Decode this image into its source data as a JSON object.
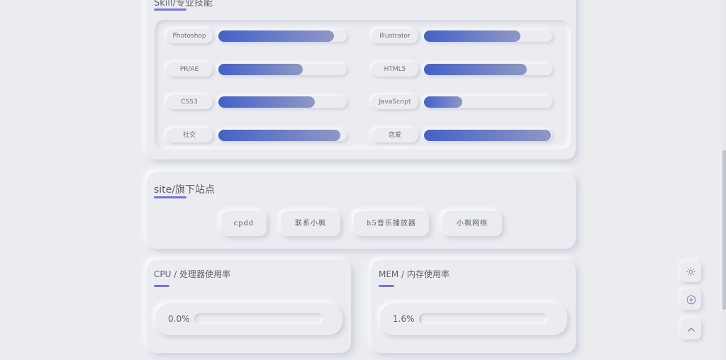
{
  "skills": {
    "title": "Skill/专业技能",
    "items": [
      {
        "label": "Photoshop",
        "level": 0.9
      },
      {
        "label": "Illustrator",
        "level": 0.75
      },
      {
        "label": "PR/AE",
        "level": 0.66
      },
      {
        "label": "HTML5",
        "level": 0.8
      },
      {
        "label": "CSS3",
        "level": 0.75
      },
      {
        "label": "JavaScript",
        "level": 0.3
      },
      {
        "label": "社交",
        "level": 0.95
      },
      {
        "label": "恋爱",
        "level": 0.99
      }
    ]
  },
  "site": {
    "title": "site/旗下站点",
    "links": [
      "cpdd",
      "联系小枫",
      "h5音乐播放器",
      "小枫网络"
    ]
  },
  "cpu": {
    "title": "CPU / 处理器使用率",
    "value": "0.0%",
    "level": 0.0
  },
  "mem": {
    "title": "MEM / 内存使用率",
    "value": "1.6%",
    "level": 0.016
  },
  "floating": {
    "icons": [
      "sun-icon",
      "add-circle-icon",
      "chevron-up-icon"
    ]
  },
  "colors": {
    "accent_start": "#4461c9",
    "accent_end": "#8f97c6",
    "background": "#ebecf0"
  }
}
